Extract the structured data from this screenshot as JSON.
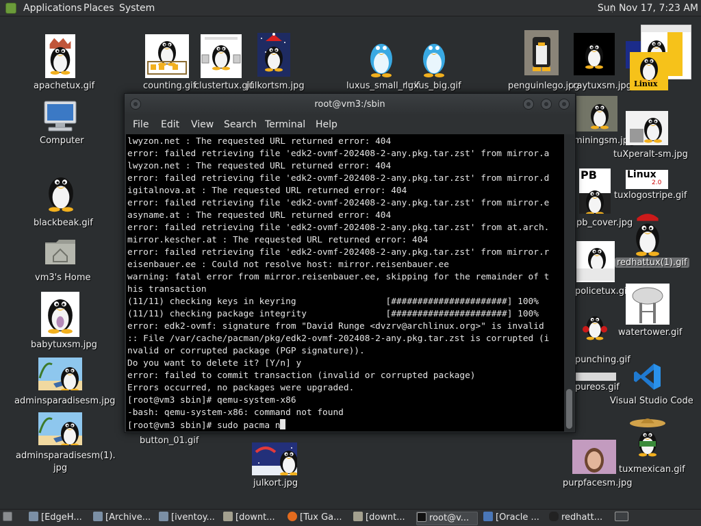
{
  "panel": {
    "menus": [
      "Applications",
      "Places",
      "System"
    ],
    "clock": "Sun Nov 17,  7:23 AM"
  },
  "desktop": {
    "icons": {
      "apachetux": "apachetux.gif",
      "counting": "counting.gif",
      "clustertux": "clustertux.gif",
      "julkortsm": "julkortsm.jpg",
      "luxus_small": "luxus_small_r.gif",
      "luxus_big": "luxus_big.gif",
      "penguinlego": "penguinlego.jpg",
      "craytuxsm": "craytuxsm.jpg",
      "computer": "Computer",
      "miningsm": "miningsm.jpg",
      "tuxperalt": "tuXperalt-sm.jpg",
      "blackbeak": "blackbeak.gif",
      "tuxlogostripe": "tuxlogostripe.gif",
      "pb_cover": "pb_cover.jpg",
      "home": "vm3's Home",
      "redhattux": "redhattux(1).gif",
      "policetux": "policetux.gif",
      "babytuxsm": "babytuxsm.jpg",
      "watertower": "watertower.gif",
      "punching": "punching.gif",
      "adminsparadise": "adminsparadisesm.jpg",
      "vscode": "Visual Studio Code",
      "pureos": "pureos.gif",
      "adminsparadise1_line1": "adminsparadisesm(1).",
      "adminsparadise1_line2": "jpg",
      "button01": "button_01.gif",
      "julkort": "julkort.jpg",
      "purpfacesm": "purpfacesm.jpg",
      "tuxmexican": "tuxmexican.gif"
    },
    "text_bits": {
      "linux_label": "Linux",
      "linux2": "Linux",
      "linux2_ver": "2.0",
      "pb": "PB"
    }
  },
  "terminal": {
    "title": "root@vm3:/sbin",
    "menu": [
      "File",
      "Edit",
      "View",
      "Search",
      "Terminal",
      "Help"
    ],
    "lines": [
      "lwyzon.net : The requested URL returned error: 404",
      "error: failed retrieving file 'edk2-ovmf-202408-2-any.pkg.tar.zst' from mirror.a",
      "lwyzon.net : The requested URL returned error: 404",
      "error: failed retrieving file 'edk2-ovmf-202408-2-any.pkg.tar.zst' from mirror.d",
      "igitalnova.at : The requested URL returned error: 404",
      "error: failed retrieving file 'edk2-ovmf-202408-2-any.pkg.tar.zst' from mirror.e",
      "asyname.at : The requested URL returned error: 404",
      "error: failed retrieving file 'edk2-ovmf-202408-2-any.pkg.tar.zst' from at.arch.",
      "mirror.kescher.at : The requested URL returned error: 404",
      "error: failed retrieving file 'edk2-ovmf-202408-2-any.pkg.tar.zst' from mirror.r",
      "eisenbauer.ee : Could not resolve host: mirror.reisenbauer.ee",
      "warning: fatal error from mirror.reisenbauer.ee, skipping for the remainder of t",
      "his transaction",
      "(11/11) checking keys in keyring                 [######################] 100%",
      "(11/11) checking package integrity               [######################] 100%",
      "error: edk2-ovmf: signature from \"David Runge <dvzrv@archlinux.org>\" is invalid",
      ":: File /var/cache/pacman/pkg/edk2-ovmf-202408-2-any.pkg.tar.zst is corrupted (i",
      "nvalid or corrupted package (PGP signature)).",
      "Do you want to delete it? [Y/n] y",
      "error: failed to commit transaction (invalid or corrupted package)",
      "Errors occurred, no packages were upgraded.",
      "[root@vm3 sbin]# qemu-system-x86",
      "-bash: qemu-system-x86: command not found"
    ],
    "prompt_line": "[root@vm3 sbin]# sudo pacma n"
  },
  "taskbar": {
    "items": [
      "[EdgeH...",
      "[Archive...",
      "[iventoy...",
      "[downt...",
      "[Tux Ga...",
      "[downt...",
      "root@v...",
      "[Oracle ...",
      "redhatt..."
    ]
  }
}
